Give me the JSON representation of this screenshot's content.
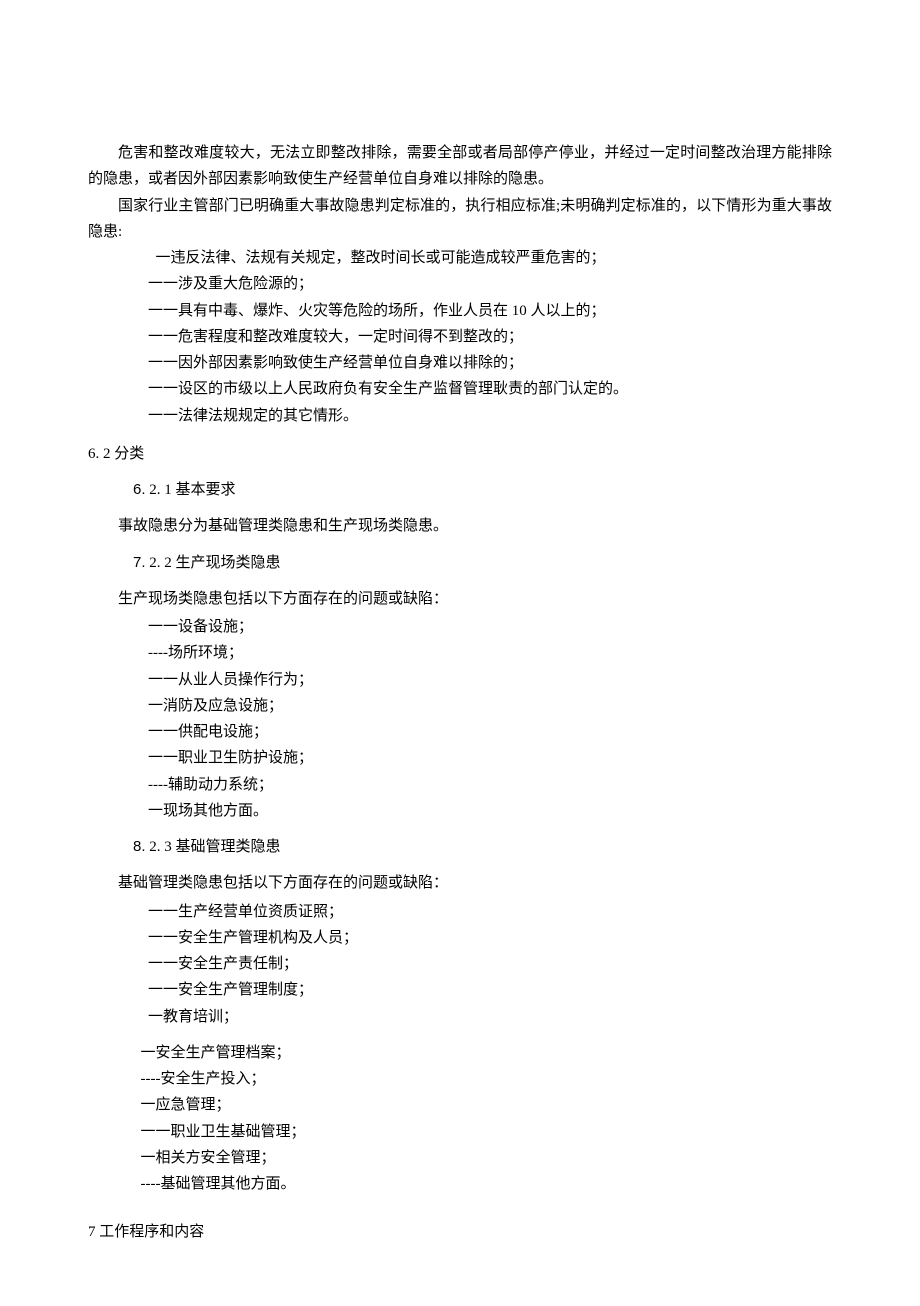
{
  "intro": {
    "p1": "危害和整改难度较大，无法立即整改排除，需要全部或者局部停产停业，并经过一定时间整改治理方能排除的隐患，或者因外部因素影响致使生产经营单位自身难以排除的隐患。",
    "p2_a": "国家行业主管部门已明确重大事故隐患判定标准的，执行相应标准",
    "p2_b": "未明确判定标准的，以下情形为重大事故隐患",
    "items": [
      "一违反法律、法规有关规定，整改时间长或可能造成较严重危害的；",
      "一一涉及重大危险源的；",
      "一一具有中毒、爆炸、火灾等危险的场所，作业人员在 10 人以上的；",
      "一一危害程度和整改难度较大，一定时间得不到整改的；",
      "一一因外部因素影响致使生产经营单位自身难以排除的；",
      "一一设区的市级以上人民政府负有安全生产监督管理耿责的部门认定的。",
      "一一法律法规规定的其它情形。"
    ]
  },
  "s62": {
    "heading": "6. 2 分类",
    "s621": {
      "num": "6.",
      "title": " 2. 1 基本要求",
      "body": "事故隐患分为基础管理类隐患和生产现场类隐患。"
    },
    "s622": {
      "num": "7.",
      "title": " 2. 2 生产现场类隐患",
      "lead": "生产现场类隐患包括以下方面存在的问题或缺陷：",
      "items": [
        "一一设备设施；",
        "----场所环境；",
        "一一从业人员操作行为；",
        "  一消防及应急设施；",
        "一一供配电设施；",
        "一一职业卫生防护设施；",
        "----辅助动力系统；",
        "  一现场其他方面。"
      ]
    },
    "s623": {
      "num": "8.",
      "title": " 2. 3 基础管理类隐患",
      "lead": "基础管理类隐患包括以下方面存在的问题或缺陷：",
      "items1": [
        "一一生产经营单位资质证照；",
        "一一安全生产管理机构及人员；",
        "一一安全生产责任制；",
        "一一安全生产管理制度；",
        "  一教育培训；"
      ],
      "items2": [
        "一安全生产管理档案；",
        "----安全生产投入；",
        "  一应急管理；",
        "一一职业卫生基础管理；",
        "  一相关方安全管理；",
        "----基础管理其他方面。"
      ]
    }
  },
  "s7": {
    "heading": "7 工作程序和内容"
  }
}
